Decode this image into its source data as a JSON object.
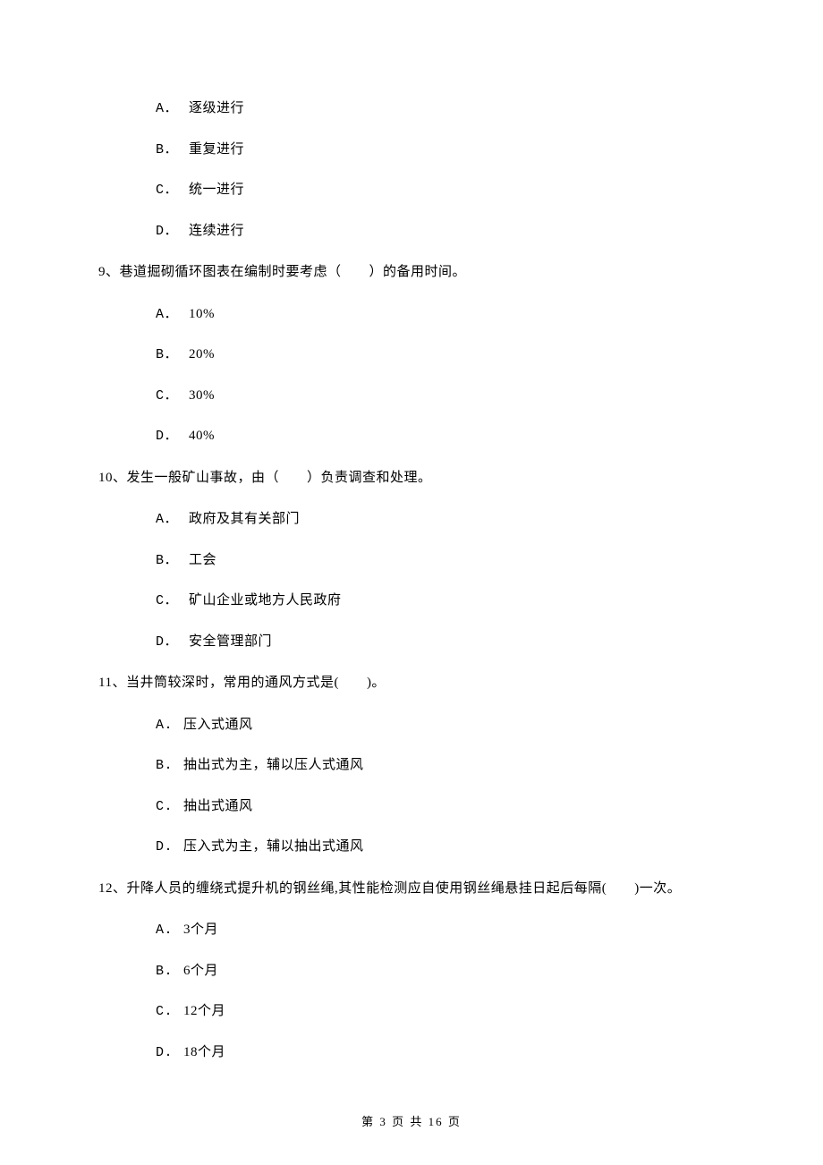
{
  "q8_opts": {
    "a": {
      "m": "A．",
      "t": "逐级进行"
    },
    "b": {
      "m": "B．",
      "t": "重复进行"
    },
    "c": {
      "m": "C．",
      "t": "统一进行"
    },
    "d": {
      "m": "D．",
      "t": "连续进行"
    }
  },
  "q9": {
    "stem": "9、巷道掘砌循环图表在编制时要考虑（　　）的备用时间。",
    "opts": {
      "a": {
        "m": "A．",
        "t": "10%"
      },
      "b": {
        "m": "B．",
        "t": "20%"
      },
      "c": {
        "m": "C．",
        "t": "30%"
      },
      "d": {
        "m": "D．",
        "t": "40%"
      }
    }
  },
  "q10": {
    "stem": "10、发生一般矿山事故，由（　　）负责调查和处理。",
    "opts": {
      "a": {
        "m": "A．",
        "t": "政府及其有关部门"
      },
      "b": {
        "m": "B．",
        "t": "工会"
      },
      "c": {
        "m": "C．",
        "t": "矿山企业或地方人民政府"
      },
      "d": {
        "m": "D．",
        "t": "安全管理部门"
      }
    }
  },
  "q11": {
    "stem": "11、当井筒较深时，常用的通风方式是(　　)。",
    "opts": {
      "a": {
        "m": "A.",
        "t": "压入式通风"
      },
      "b": {
        "m": "B.",
        "t": "抽出式为主，辅以压人式通风"
      },
      "c": {
        "m": "C.",
        "t": "抽出式通风"
      },
      "d": {
        "m": "D.",
        "t": "压入式为主，辅以抽出式通风"
      }
    }
  },
  "q12": {
    "stem": "12、升降人员的缠绕式提升机的钢丝绳,其性能检测应自使用钢丝绳悬挂日起后每隔(　　)一次。",
    "opts": {
      "a": {
        "m": "A.",
        "t": "3个月"
      },
      "b": {
        "m": "B.",
        "t": "6个月"
      },
      "c": {
        "m": "C.",
        "t": "12个月"
      },
      "d": {
        "m": "D.",
        "t": "18个月"
      }
    }
  },
  "footer": "第 3 页 共 16 页"
}
